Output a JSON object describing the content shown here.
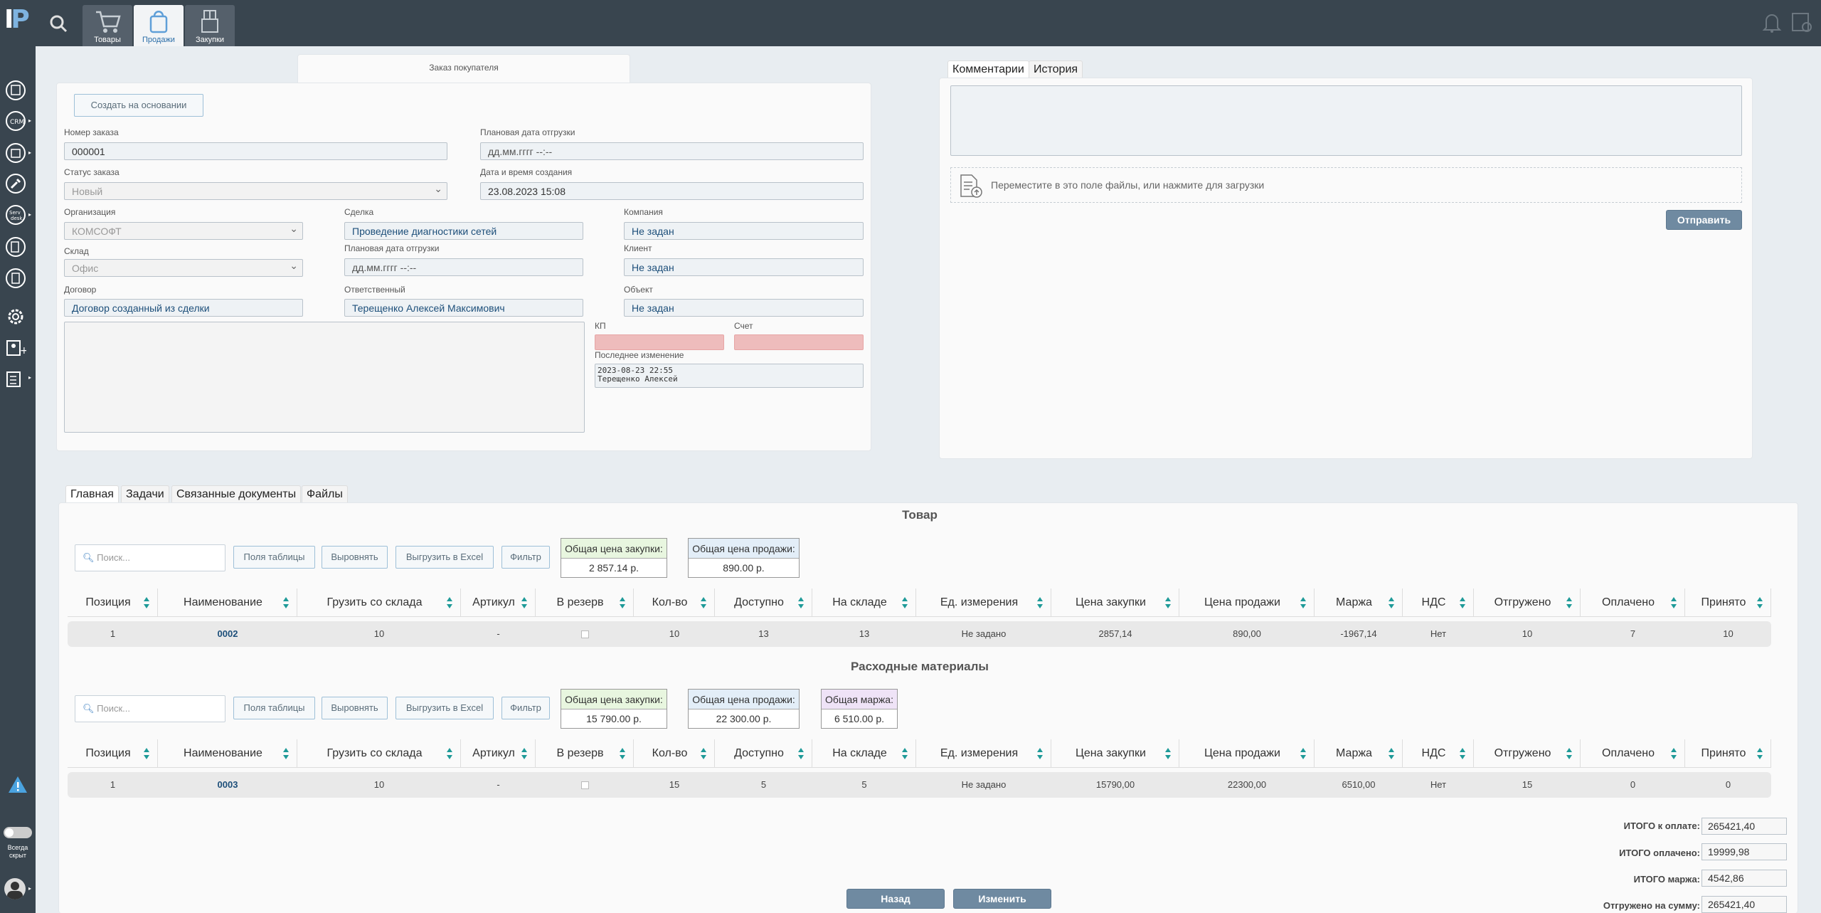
{
  "topbar": {
    "tabs": [
      {
        "label": "Товары",
        "icon": "cart-icon"
      },
      {
        "label": "Продажи",
        "icon": "shopping-bag-icon"
      },
      {
        "label": "Закупки",
        "icon": "box-icon"
      }
    ]
  },
  "sidebar": {
    "toggle_label": "Всегда скрыт"
  },
  "order": {
    "panel_title": "Заказ покупателя",
    "create_based_button": "Создать на основании",
    "order_number_label": "Номер заказа",
    "order_number": "000001",
    "planned_ship_label": "Плановая дата отгрузки",
    "planned_ship_value": "дд.мм.гггг --:--",
    "status_label": "Статус заказа",
    "status_value": "Новый",
    "created_label": "Дата и время создания",
    "created_value": "23.08.2023 15:08",
    "organization_label": "Организация",
    "organization_value": "КОМСОФТ",
    "deal_label": "Сделка",
    "deal_value": "Проведение диагностики сетей",
    "company_label": "Компания",
    "company_value": "Не задан",
    "warehouse_label": "Склад",
    "warehouse_value": "Офис",
    "planned_ship2_label": "Плановая дата отгрузки",
    "planned_ship2_value": "дд.мм.гггг --:--",
    "client_label": "Клиент",
    "client_value": "Не задан",
    "contract_label": "Договор",
    "contract_value": "Договор созданный из сделки",
    "responsible_label": "Ответственный",
    "responsible_value": "Терещенко Алексей Максимович",
    "object_label": "Объект",
    "object_value": "Не задан",
    "kp_label": "КП",
    "invoice_label": "Счет",
    "last_change_label": "Последнее изменение",
    "last_change_line1": "2023-08-23 22:55",
    "last_change_line2": "Терещенко Алексей"
  },
  "comments": {
    "tabs": [
      "Комментарии",
      "История"
    ],
    "upload_text": "Переместите в это поле файлы, или нажмите для загрузки",
    "send_button": "Отправить"
  },
  "bottom_tabs": [
    "Главная",
    "Задачи",
    "Связанные документы",
    "Файлы"
  ],
  "toolbar": {
    "search_placeholder": "Поиск...",
    "fields_button": "Поля таблицы",
    "align_button": "Выровнять",
    "excel_button": "Выгрузить в Excel",
    "filter_button": "Фильтр"
  },
  "columns": [
    "Позиция",
    "Наименование",
    "Грузить со склада",
    "Артикул",
    "В резерв",
    "Кол-во",
    "Доступно",
    "На складе",
    "Ед. измерения",
    "Цена закупки",
    "Цена продажи",
    "Маржа",
    "НДС",
    "Отгружено",
    "Оплачено",
    "Принято"
  ],
  "goods": {
    "title": "Товар",
    "total_purchase_label": "Общая цена закупки:",
    "total_purchase_value": "2 857.14 р.",
    "total_sale_label": "Общая цена продажи:",
    "total_sale_value": "890.00 р.",
    "rows": [
      [
        "1",
        "0002",
        "10",
        "-",
        "",
        "10",
        "13",
        "13",
        "Не задано",
        "2857,14",
        "890,00",
        "-1967,14",
        "Нет",
        "10",
        "7",
        "10"
      ]
    ]
  },
  "materials": {
    "title": "Расходные материалы",
    "total_purchase_label": "Общая цена закупки:",
    "total_purchase_value": "15 790.00 р.",
    "total_sale_label": "Общая цена продажи:",
    "total_sale_value": "22 300.00 р.",
    "total_margin_label": "Общая маржа:",
    "total_margin_value": "6 510.00 р.",
    "rows": [
      [
        "1",
        "0003",
        "10",
        "-",
        "",
        "15",
        "5",
        "5",
        "Не задано",
        "15790,00",
        "22300,00",
        "6510,00",
        "Нет",
        "15",
        "0",
        "0"
      ]
    ]
  },
  "totals": {
    "to_pay_label": "ИТОГО к оплате:",
    "to_pay_value": "265421,40",
    "paid_label": "ИТОГО оплачено:",
    "paid_value": "19999,98",
    "margin_label": "ИТОГО маржа:",
    "margin_value": "4542,86",
    "shipped_label": "Отгружено на сумму:",
    "shipped_value": "265421,40"
  },
  "actions": {
    "back_button": "Назад",
    "edit_button": "Изменить"
  },
  "colors": {
    "topbar": "#39454f",
    "accent": "#6f8aa1",
    "purchase_box": "#e8f6df",
    "sale_box": "#e3eef8",
    "margin_box": "#efe3f7",
    "pink_field": "#eebcbc"
  }
}
